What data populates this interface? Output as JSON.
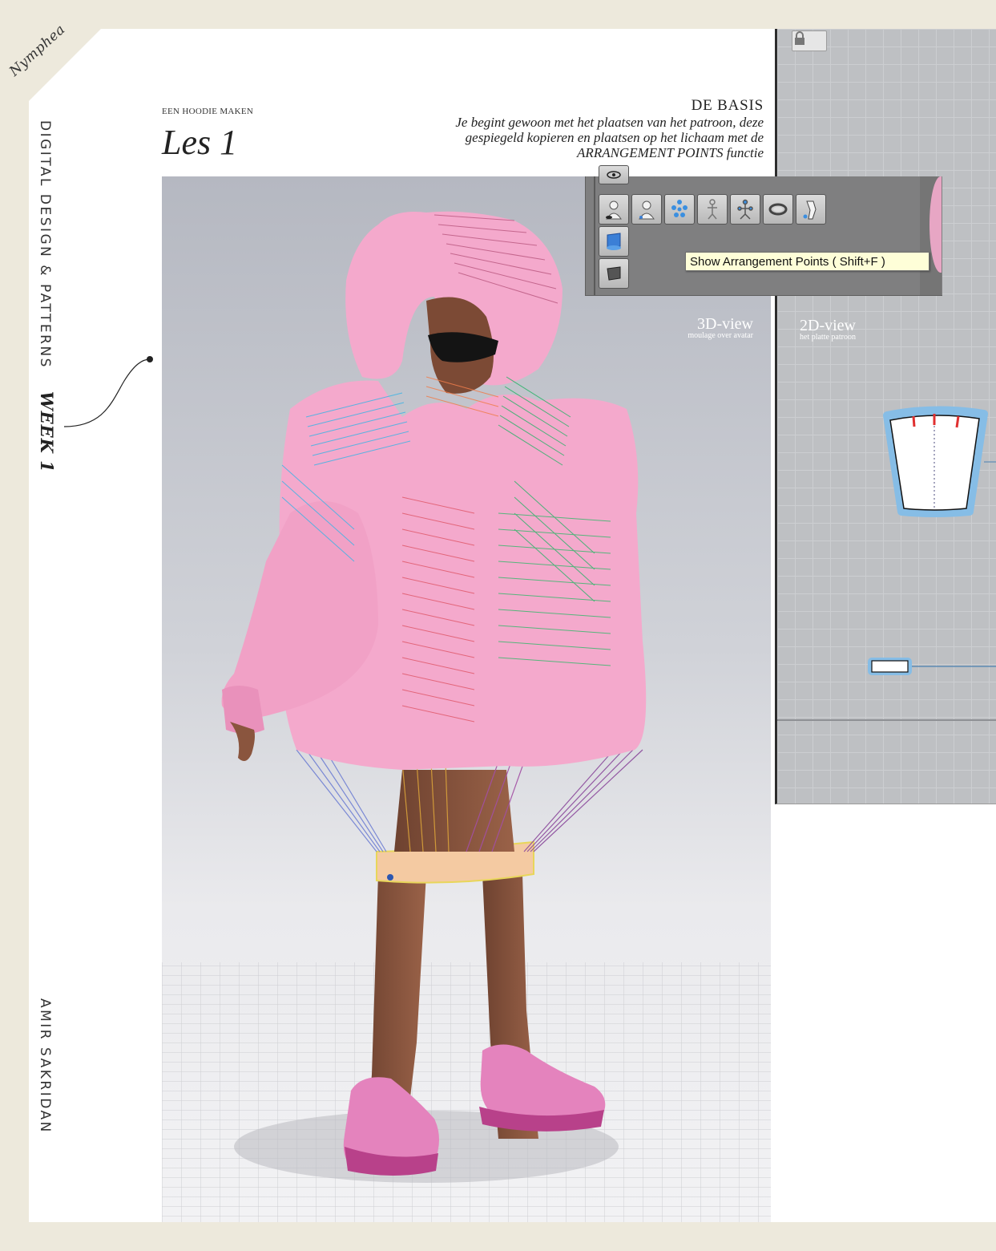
{
  "branding": {
    "logo_text": "Nymphea"
  },
  "sidebar": {
    "course": "DIGITAL DESIGN & PATTERNS",
    "week": "WEEK 1",
    "author": "AMIR SAKRIDAN"
  },
  "header": {
    "kicker": "EEN HOODIE MAKEN",
    "lesson": "Les 1"
  },
  "intro": {
    "title": "DE BASIS",
    "lines": [
      "Je begint gewoon met het plaatsen van het patroon, deze",
      "gespiegeld kopieren en plaatsen op het lichaam met de",
      "ARRANGEMENT POINTS functie"
    ]
  },
  "views": {
    "view3d": {
      "title": "3D-view",
      "subtitle": "moulage over avatar"
    },
    "view2d": {
      "title": "2D-view",
      "subtitle": "het platte patroon"
    }
  },
  "toolbar": {
    "tooltip": "Show Arrangement Points ( Shift+F )",
    "icons": [
      "avatar-eye-icon",
      "avatar-show-icon",
      "arrangement-points-icon",
      "skeleton-icon",
      "skeleton-joints-icon",
      "measure-tape-icon",
      "fit-pose-icon"
    ],
    "side_icons": [
      "garment-visibility-icon",
      "shape-visibility-icon"
    ]
  },
  "colors": {
    "hoodie": "#f2a7c8",
    "accent_blue": "#6aa6d8",
    "tooltip_bg": "#fefed8",
    "page_bg": "#ede9dc"
  }
}
